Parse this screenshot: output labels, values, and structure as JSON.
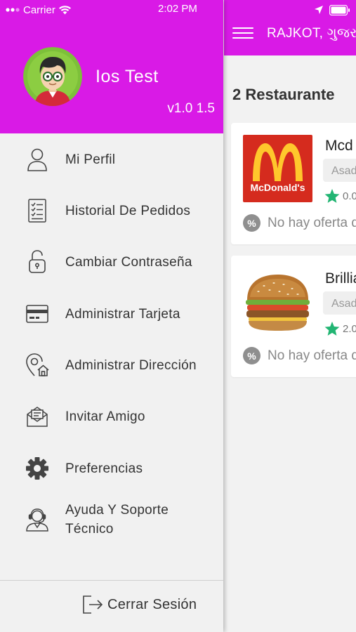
{
  "status_bar": {
    "carrier": "Carrier",
    "time": "2:02 PM"
  },
  "colors": {
    "brand": "#d91ae6",
    "star": "#22b573"
  },
  "drawer": {
    "user_name": "Ios Test",
    "version": "v1.0 1.5",
    "menu": [
      {
        "label": "Mi Perfil",
        "icon": "user-icon"
      },
      {
        "label": "Historial De Pedidos",
        "icon": "order-history-icon"
      },
      {
        "label": "Cambiar Contraseña",
        "icon": "lock-icon"
      },
      {
        "label": "Administrar Tarjeta",
        "icon": "credit-card-icon"
      },
      {
        "label": "Administrar Dirección",
        "icon": "address-pin-icon"
      },
      {
        "label": "Invitar Amigo",
        "icon": "invite-envelope-icon"
      },
      {
        "label": "Preferencias",
        "icon": "gear-icon"
      },
      {
        "label": "Ayuda Y Soporte Técnico",
        "icon": "support-agent-icon"
      }
    ],
    "logout_label": "Cerrar Sesión"
  },
  "main": {
    "city": "RAJKOT, ગુજરા",
    "count_title": "2 Restaurante",
    "restaurants": [
      {
        "name": "Mcd",
        "tag": "Asad",
        "rating": "0.0",
        "offer": "No hay oferta d",
        "logo_text": "McDonald's"
      },
      {
        "name": "Brillia",
        "tag": "Asad",
        "rating": "2.0",
        "offer": "No hay oferta d"
      }
    ]
  }
}
